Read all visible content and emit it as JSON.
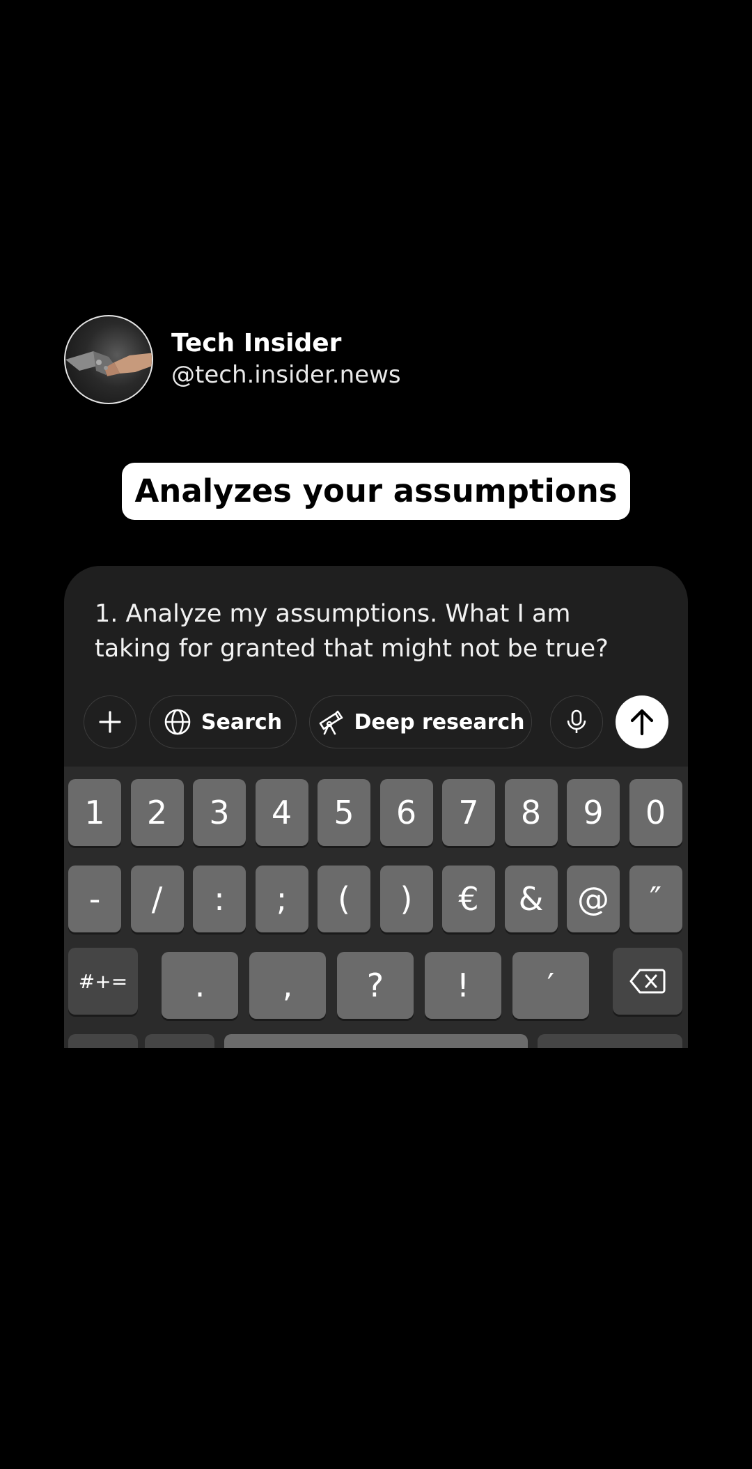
{
  "profile": {
    "name": "Tech Insider",
    "handle": "@tech.insider.news",
    "avatar_icon": "handshake-robot-human-icon"
  },
  "caption": "Analyzes your assumptions",
  "chat": {
    "prompt_text": "1. Analyze my assumptions. What I am taking for granted that might not be true?",
    "buttons": {
      "add_icon": "plus-icon",
      "search_label": "Search",
      "search_icon": "globe-icon",
      "deep_research_label": "Deep research",
      "deep_research_icon": "telescope-icon",
      "mic_icon": "microphone-icon",
      "send_icon": "arrow-up-icon"
    }
  },
  "keyboard": {
    "row1": [
      "1",
      "2",
      "3",
      "4",
      "5",
      "6",
      "7",
      "8",
      "9",
      "0"
    ],
    "row2": [
      "-",
      "/",
      ":",
      ";",
      "(",
      ")",
      "€",
      "&",
      "@",
      "″"
    ],
    "row3": {
      "mode_key": "#+=",
      "keys": [
        ".",
        ",",
        "?",
        "!",
        "′"
      ],
      "delete_icon": "backspace-icon"
    }
  },
  "colors": {
    "background": "#000000",
    "card": "#1f1f1f",
    "key": "#6b6b6b",
    "key_dark": "#454545"
  }
}
